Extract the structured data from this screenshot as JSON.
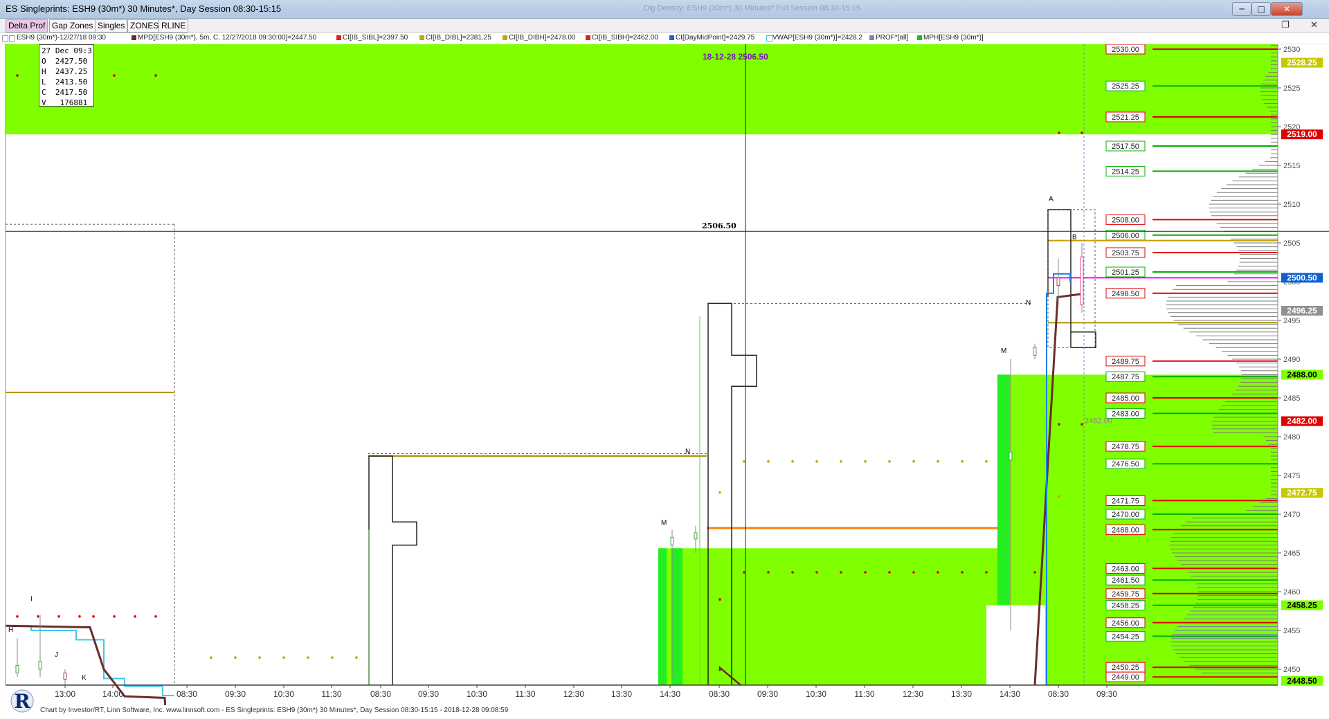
{
  "window": {
    "title": "ES Singleprints: ESH9 (30m*) 30 Minutes*, Day Session 08:30-15:15",
    "ghost_title": "Dig Density: ESH9 (30m*) 30 Minutes* Full Session 08:30-15:15",
    "restore_glyph": "❐",
    "min_glyph": "─",
    "max_glyph": "□",
    "close_glyph": "✕"
  },
  "toolbar": {
    "buttons": [
      "Delta Prof",
      "Gap Zones",
      "Singles",
      "ZONES",
      "RLINE"
    ],
    "restore_icon": "❐",
    "close_icon": "✕"
  },
  "legend": [
    {
      "text": "ESH9 (30m*)-12/27/18 09:30",
      "color": "#ffffff"
    },
    {
      "text": "MPD[ESH9 (30m*), 5m, C, 12/27/2018 09:30:00]=2447.50",
      "color": "#6b2c2c"
    },
    {
      "text": "CI[IB_SIBL]=2397.50",
      "color": "#e02020"
    },
    {
      "text": "CI[IB_DIBL]=2381.25",
      "color": "#c8a800"
    },
    {
      "text": "CI[IB_DIBH]=2478.00",
      "color": "#c8a800"
    },
    {
      "text": "CI[IB_SIBH]=2462.00",
      "color": "#e02020"
    },
    {
      "text": "CI[DayMidPoint]=2429.75",
      "color": "#2060e0"
    },
    {
      "text": "VWAP[ESH9 (30m*)]=2428.2",
      "color": "#40c8e8"
    },
    {
      "text": "PROF*[all]",
      "color": "#8080c0"
    },
    {
      "text": "MPH[ESH9 (30m*)]",
      "color": "#20c020"
    }
  ],
  "ohlc_box": {
    "date": "27 Dec 09:3",
    "open": "O  2427.50",
    "high": "H  2437.25",
    "low": "L  2413.50",
    "close": "C  2417.50",
    "volume": "V   176881"
  },
  "chart_data": {
    "type": "candlestick-market-profile",
    "crosshair_label": "18-12-28  2506.50",
    "crosshair_price": "2506.50",
    "price_axis": {
      "ticks": [
        "2530",
        "2525",
        "2520",
        "2515",
        "2510",
        "2505",
        "2500",
        "2495",
        "2490",
        "2485",
        "2480",
        "2475",
        "2470",
        "2465",
        "2460",
        "2455",
        "2450"
      ],
      "range": [
        2447.5,
        2531
      ]
    },
    "time_axis": {
      "ticks": [
        "13:00",
        "14:00",
        "08:30",
        "09:30",
        "10:30",
        "11:30",
        "08:30",
        "09:30",
        "10:30",
        "11:30",
        "12:30",
        "13:30",
        "14:30",
        "08:30",
        "09:30",
        "10:30",
        "11:30",
        "12:30",
        "13:30",
        "14:30",
        "08:30",
        "09:30"
      ]
    },
    "right_labels": [
      {
        "text": "2528.25",
        "price": 2528.25,
        "bg": "#c8c800",
        "fg": "#fff"
      },
      {
        "text": "2519.00",
        "price": 2519.0,
        "bg": "#e00000",
        "fg": "#fff"
      },
      {
        "text": "2500.50",
        "price": 2500.5,
        "bg": "#1060d0",
        "fg": "#fff"
      },
      {
        "text": "2496.25",
        "price": 2496.25,
        "bg": "#909090",
        "fg": "#fff"
      },
      {
        "text": "2488.00",
        "price": 2488.0,
        "bg": "#80ff00",
        "fg": "#000"
      },
      {
        "text": "2482.00",
        "price": 2482.0,
        "bg": "#e00000",
        "fg": "#fff"
      },
      {
        "text": "2472.75",
        "price": 2472.75,
        "bg": "#c8c800",
        "fg": "#fff"
      },
      {
        "text": "2458.25",
        "price": 2458.25,
        "bg": "#80ff00",
        "fg": "#000"
      },
      {
        "text": "2448.50",
        "price": 2448.5,
        "bg": "#80ff00",
        "fg": "#000"
      }
    ],
    "level_lines": [
      {
        "text": "2530.00",
        "price": 2530.0,
        "color": "red"
      },
      {
        "text": "2525.25",
        "price": 2525.25,
        "color": "green"
      },
      {
        "text": "2521.25",
        "price": 2521.25,
        "color": "red"
      },
      {
        "text": "2517.50",
        "price": 2517.5,
        "color": "green"
      },
      {
        "text": "2514.25",
        "price": 2514.25,
        "color": "green"
      },
      {
        "text": "2508.00",
        "price": 2508.0,
        "color": "red"
      },
      {
        "text": "2506.00",
        "price": 2506.0,
        "color": "green"
      },
      {
        "text": "2503.75",
        "price": 2503.75,
        "color": "red"
      },
      {
        "text": "2501.25",
        "price": 2501.25,
        "color": "green"
      },
      {
        "text": "2498.50",
        "price": 2498.5,
        "color": "red"
      },
      {
        "text": "2489.75",
        "price": 2489.75,
        "color": "red"
      },
      {
        "text": "2487.75",
        "price": 2487.75,
        "color": "green"
      },
      {
        "text": "2485.00",
        "price": 2485.0,
        "color": "red"
      },
      {
        "text": "2483.00",
        "price": 2483.0,
        "color": "green"
      },
      {
        "text": "2478.75",
        "price": 2478.75,
        "color": "red"
      },
      {
        "text": "2476.50",
        "price": 2476.5,
        "color": "green"
      },
      {
        "text": "2471.75",
        "price": 2471.75,
        "color": "red"
      },
      {
        "text": "2470.00",
        "price": 2470.0,
        "color": "green"
      },
      {
        "text": "2468.00",
        "price": 2468.0,
        "color": "red"
      },
      {
        "text": "2463.00",
        "price": 2463.0,
        "color": "red"
      },
      {
        "text": "2461.50",
        "price": 2461.5,
        "color": "green"
      },
      {
        "text": "2459.75",
        "price": 2459.75,
        "color": "red"
      },
      {
        "text": "2458.25",
        "price": 2458.25,
        "color": "green"
      },
      {
        "text": "2456.00",
        "price": 2456.0,
        "color": "red"
      },
      {
        "text": "2454.25",
        "price": 2454.25,
        "color": "green"
      },
      {
        "text": "2450.25",
        "price": 2450.25,
        "color": "red"
      },
      {
        "text": "2449.00",
        "price": 2449.0,
        "color": "red"
      }
    ],
    "inline_label": "2482.00",
    "letters": [
      {
        "t": "H",
        "price": 2454.8
      },
      {
        "t": "I",
        "price": 2458.8
      },
      {
        "t": "J",
        "price": 2451.6
      },
      {
        "t": "K",
        "price": 2448.6
      },
      {
        "t": "N",
        "price": 2477.8
      },
      {
        "t": "M",
        "price": 2468.6
      },
      {
        "t": "M",
        "price": 2490.8
      },
      {
        "t": "N",
        "price": 2497.0
      },
      {
        "t": "A",
        "price": 2510.4
      },
      {
        "t": "B",
        "price": 2505.5
      }
    ]
  },
  "footer": {
    "text": "Chart by Investor/RT, Linn Software, Inc. www.linnsoft.com - ES Singleprints: ESH9 (30m*) 30 Minutes*, Day Session 08:30-15:15 - 2018-12-28 09:08:59",
    "logo_letter": "R"
  }
}
